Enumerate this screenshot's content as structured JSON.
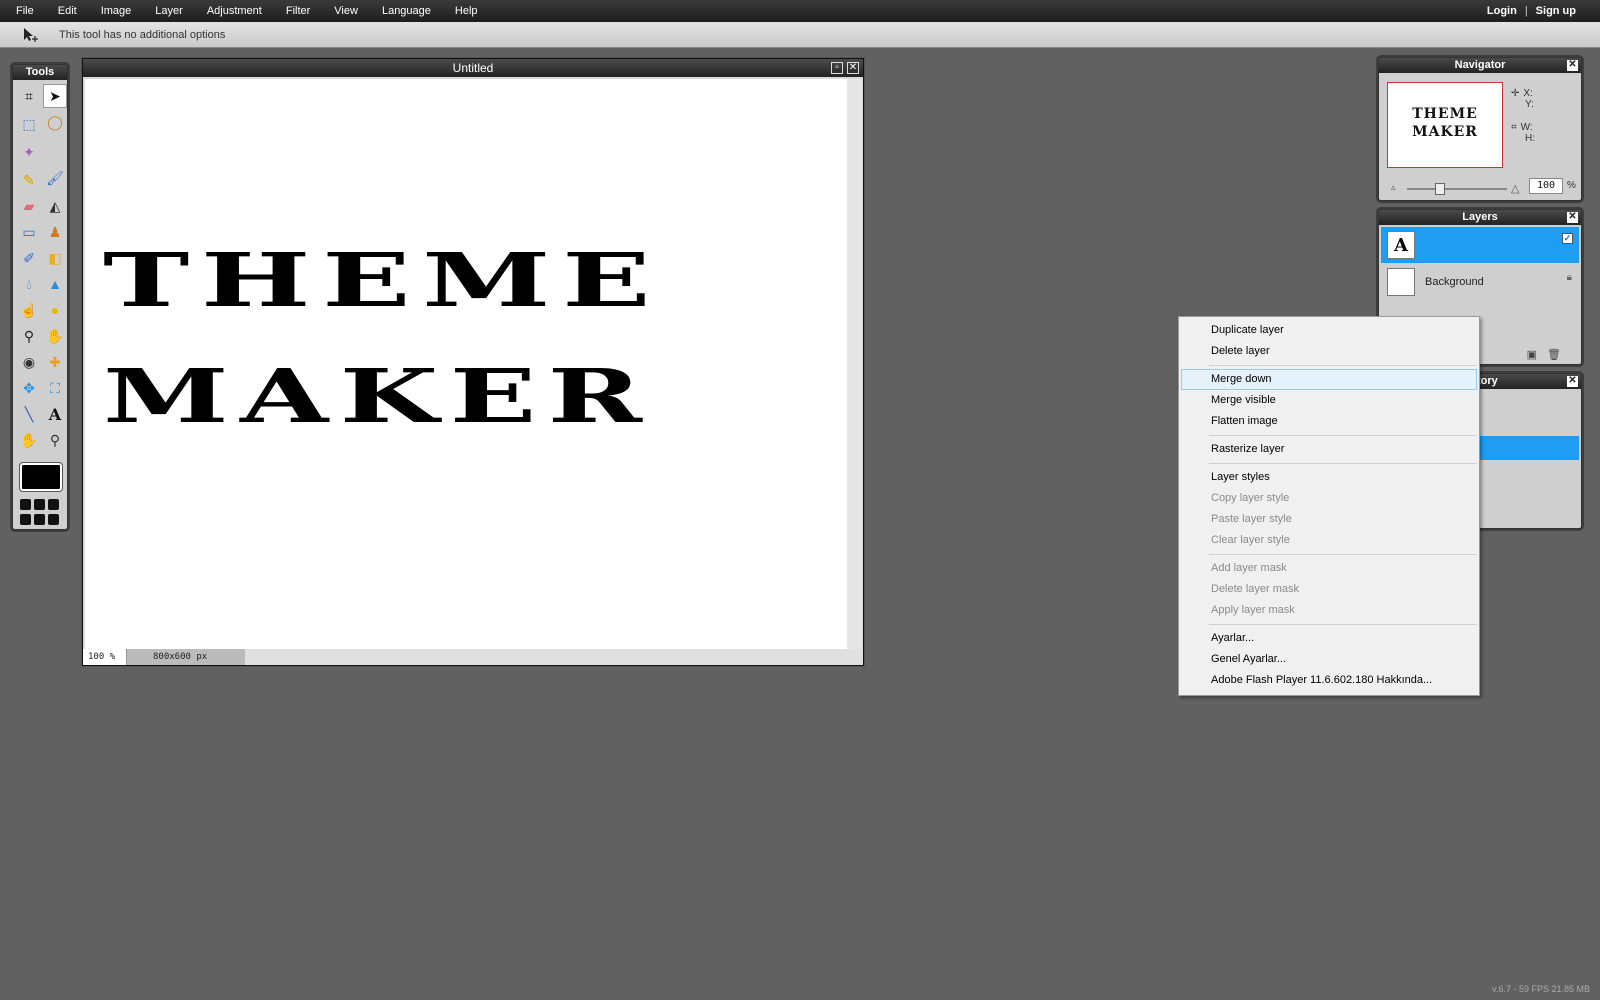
{
  "menubar": {
    "items": [
      "File",
      "Edit",
      "Image",
      "Layer",
      "Adjustment",
      "Filter",
      "View",
      "Language",
      "Help"
    ],
    "login": "Login",
    "separator": "|",
    "signup": "Sign up"
  },
  "options": {
    "text": "This tool has no additional options"
  },
  "tools": {
    "title": "Tools",
    "items": [
      "crop-icon",
      "move-icon",
      "marquee-icon",
      "lasso-icon",
      "magic-wand-icon",
      "",
      "pencil-icon",
      "brush-icon",
      "eraser-icon",
      "paint-bucket-icon",
      "gradient-icon",
      "clone-stamp-icon",
      "color-replace-icon",
      "shape-icon",
      "blur-icon",
      "sharpen-icon",
      "smudge-icon",
      "sponge-icon",
      "dodge-icon",
      "burn-icon",
      "red-eye-icon",
      "spot-heal-icon",
      "bloat-icon",
      "pinch-icon",
      "color-picker-icon",
      "type-icon",
      "hand-icon",
      "zoom-icon"
    ]
  },
  "document": {
    "title": "Untitled",
    "line1": "THEME",
    "line2": "MAKER",
    "zoom": "100 %",
    "dimensions": "800x600 px"
  },
  "navigator": {
    "title": "Navigator",
    "thumb_line1": "THEME",
    "thumb_line2": "MAKER",
    "x_label": "X:",
    "y_label": "Y:",
    "w_label": "W:",
    "h_label": "H:",
    "zoom_value": "100",
    "zoom_unit": "%"
  },
  "layers": {
    "title": "Layers",
    "items": [
      {
        "thumb": "A",
        "name": "",
        "selected": true
      },
      {
        "thumb": "",
        "name": "Background",
        "selected": false
      }
    ]
  },
  "history": {
    "title_visible": "tory"
  },
  "context_menu": {
    "groups": [
      [
        {
          "label": "Duplicate layer",
          "enabled": true
        },
        {
          "label": "Delete layer",
          "enabled": true
        }
      ],
      [
        {
          "label": "Merge down",
          "enabled": true,
          "hover": true
        },
        {
          "label": "Merge visible",
          "enabled": true
        },
        {
          "label": "Flatten image",
          "enabled": true
        }
      ],
      [
        {
          "label": "Rasterize layer",
          "enabled": true
        }
      ],
      [
        {
          "label": "Layer styles",
          "enabled": true
        },
        {
          "label": "Copy layer style",
          "enabled": false
        },
        {
          "label": "Paste layer style",
          "enabled": false
        },
        {
          "label": "Clear layer style",
          "enabled": false
        }
      ],
      [
        {
          "label": "Add layer mask",
          "enabled": false
        },
        {
          "label": "Delete layer mask",
          "enabled": false
        },
        {
          "label": "Apply layer mask",
          "enabled": false
        }
      ],
      [
        {
          "label": "Ayarlar...",
          "enabled": true
        },
        {
          "label": "Genel Ayarlar...",
          "enabled": true
        },
        {
          "label": "Adobe Flash Player 11.6.602.180 Hakkında...",
          "enabled": true
        }
      ]
    ]
  },
  "footer": {
    "version": "v.6.7 - 59 FPS 21.85 MB"
  },
  "colors": {
    "background": "#616161",
    "selection": "#1f9df2",
    "foreground_color": "#000000"
  }
}
